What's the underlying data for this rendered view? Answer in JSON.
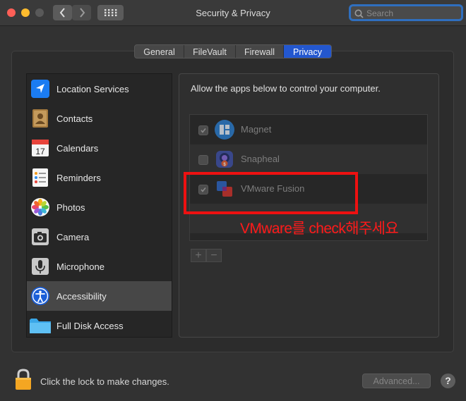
{
  "window": {
    "title": "Security & Privacy",
    "search_placeholder": "Search"
  },
  "tabs": [
    {
      "label": "General"
    },
    {
      "label": "FileVault"
    },
    {
      "label": "Firewall"
    },
    {
      "label": "Privacy",
      "active": true
    }
  ],
  "sidebar": {
    "selected": "Accessibility",
    "items": [
      {
        "label": "Location Services",
        "icon": "location-arrow-icon"
      },
      {
        "label": "Contacts",
        "icon": "contacts-book-icon"
      },
      {
        "label": "Calendars",
        "icon": "calendar-icon",
        "icon_text": "17"
      },
      {
        "label": "Reminders",
        "icon": "reminders-list-icon"
      },
      {
        "label": "Photos",
        "icon": "photos-flower-icon"
      },
      {
        "label": "Camera",
        "icon": "camera-icon"
      },
      {
        "label": "Microphone",
        "icon": "microphone-icon"
      },
      {
        "label": "Accessibility",
        "icon": "accessibility-icon"
      },
      {
        "label": "Full Disk Access",
        "icon": "folder-icon"
      }
    ]
  },
  "main": {
    "instruction": "Allow the apps below to control your computer.",
    "apps": [
      {
        "name": "Magnet",
        "checked": true,
        "icon": "magnet-app-icon"
      },
      {
        "name": "Snapheal",
        "checked": false,
        "icon": "snapheal-app-icon"
      },
      {
        "name": "VMware Fusion",
        "checked": true,
        "icon": "vmware-fusion-app-icon"
      }
    ],
    "add_label": "+",
    "remove_label": "−"
  },
  "annotation": {
    "text": "VMware를 check해주세요",
    "color": "#ff1a1a"
  },
  "footer": {
    "lock_text": "Click the lock to make changes.",
    "advanced_label": "Advanced...",
    "help_label": "?"
  },
  "colors": {
    "accent": "#2357cf",
    "window_bg": "#323232",
    "highlight_red": "#ee1111"
  }
}
